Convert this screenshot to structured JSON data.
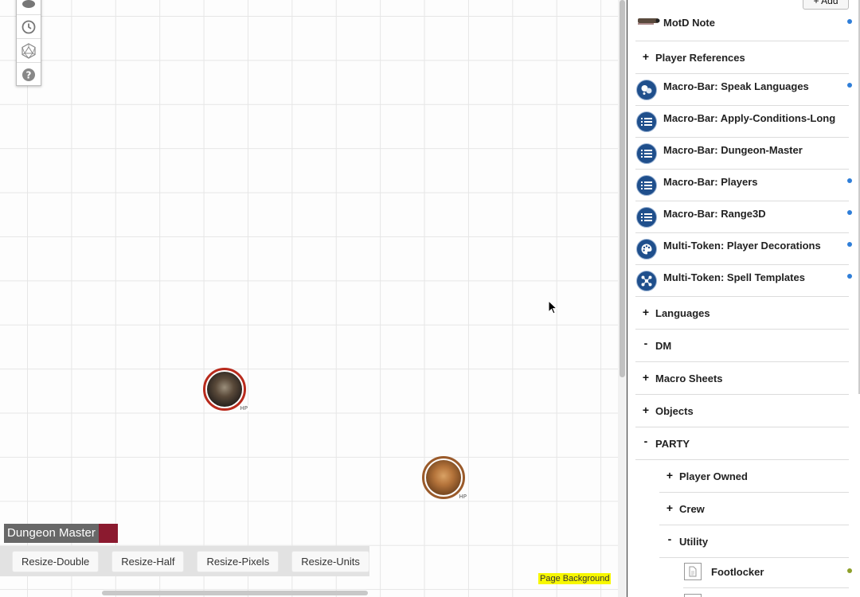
{
  "map": {
    "toolbar_icons": [
      "cloud-icon",
      "clock-icon",
      "d20-icon",
      "help-icon"
    ],
    "tokens": [
      {
        "name": "skull-warrior-token",
        "badge": "HP"
      },
      {
        "name": "bronze-golem-token",
        "badge": "HP"
      }
    ],
    "player_tag": {
      "name": "Dungeon Master",
      "color": "#8b1a2f"
    },
    "resize_buttons": [
      "Resize-Double",
      "Resize-Half",
      "Resize-Pixels",
      "Resize-Units"
    ],
    "page_background_label": "Page Background"
  },
  "panel": {
    "add_button": "+ Add",
    "items": [
      {
        "kind": "journal",
        "icon": "scroll-image-icon",
        "label": "MotD Note",
        "dot": true
      },
      {
        "kind": "folder",
        "sign": "+",
        "label": "Player References"
      },
      {
        "kind": "journal",
        "icon": "speech-icon",
        "label": "Macro-Bar: Speak Languages",
        "dot": true
      },
      {
        "kind": "journal",
        "icon": "list-icon",
        "label": "Macro-Bar: Apply-Conditions-Long",
        "dot": false
      },
      {
        "kind": "journal",
        "icon": "list-icon",
        "label": "Macro-Bar: Dungeon-Master",
        "dot": false
      },
      {
        "kind": "journal",
        "icon": "list-icon",
        "label": "Macro-Bar: Players",
        "dot": true
      },
      {
        "kind": "journal",
        "icon": "list-icon",
        "label": "Macro-Bar: Range3D",
        "dot": true
      },
      {
        "kind": "journal",
        "icon": "palette-icon",
        "label": "Multi-Token: Player Decorations",
        "dot": true
      },
      {
        "kind": "journal",
        "icon": "molecule-icon",
        "label": "Multi-Token: Spell Templates",
        "dot": true
      },
      {
        "kind": "folder",
        "sign": "+",
        "label": "Languages"
      },
      {
        "kind": "folder",
        "sign": "-",
        "label": "DM"
      },
      {
        "kind": "folder",
        "sign": "+",
        "label": "Macro Sheets"
      },
      {
        "kind": "folder",
        "sign": "+",
        "label": "Objects"
      },
      {
        "kind": "folder",
        "sign": "-",
        "label": "PARTY"
      },
      {
        "kind": "folder",
        "sign": "+",
        "label": "Player Owned"
      },
      {
        "kind": "folder",
        "sign": "+",
        "label": "Crew"
      },
      {
        "kind": "folder",
        "sign": "-",
        "label": "Utility"
      },
      {
        "kind": "journal",
        "icon": "document-icon",
        "label": "Footlocker",
        "dot": true
      }
    ],
    "colors": {
      "dot_blue": "#2f7ed8",
      "dot_olive": "#8ea02a",
      "avatar_blue": "#1f4f8c"
    }
  }
}
